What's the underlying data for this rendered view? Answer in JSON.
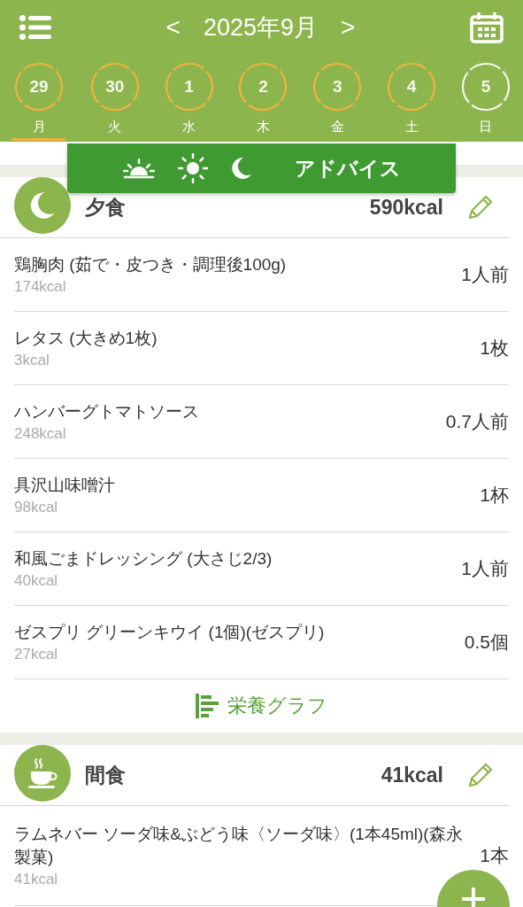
{
  "header": {
    "title": "2025年9月",
    "prev": "<",
    "next": ">"
  },
  "days": [
    {
      "date": "29",
      "weekday": "月",
      "selected": true,
      "color": "#f2b33d"
    },
    {
      "date": "30",
      "weekday": "火",
      "selected": false,
      "color": "#f2b33d"
    },
    {
      "date": "1",
      "weekday": "水",
      "selected": false,
      "color": "#f2b33d"
    },
    {
      "date": "2",
      "weekday": "木",
      "selected": false,
      "color": "#f2b33d"
    },
    {
      "date": "3",
      "weekday": "金",
      "selected": false,
      "color": "#f2b33d"
    },
    {
      "date": "4",
      "weekday": "土",
      "selected": false,
      "color": "#f2b33d"
    },
    {
      "date": "5",
      "weekday": "日",
      "selected": false,
      "color": "#f4f7ec"
    }
  ],
  "advice": {
    "label": "アドバイス"
  },
  "meals": [
    {
      "kind": "dinner",
      "name": "夕食",
      "kcal": "590kcal",
      "graph_link": "栄養グラフ",
      "items": [
        {
          "name": "鶏胸肉 (茹で・皮つき・調理後100g)",
          "kcal": "174kcal",
          "amount": "1人前"
        },
        {
          "name": "レタス (大きめ1枚)",
          "kcal": "3kcal",
          "amount": "1枚"
        },
        {
          "name": "ハンバーグトマトソース",
          "kcal": "248kcal",
          "amount": "0.7人前"
        },
        {
          "name": "具沢山味噌汁",
          "kcal": "98kcal",
          "amount": "1杯"
        },
        {
          "name": "和風ごまドレッシング (大さじ2/3)",
          "kcal": "40kcal",
          "amount": "1人前"
        },
        {
          "name": "ゼスプリ グリーンキウイ (1個)(ゼスプリ)",
          "kcal": "27kcal",
          "amount": "0.5個"
        }
      ]
    },
    {
      "kind": "snack",
      "name": "間食",
      "kcal": "41kcal",
      "items": [
        {
          "name": "ラムネバー ソーダ味&ぶどう味〈ソーダ味〉(1本45ml)(森永製菓)",
          "kcal": "41kcal",
          "amount": "1本"
        }
      ]
    }
  ]
}
